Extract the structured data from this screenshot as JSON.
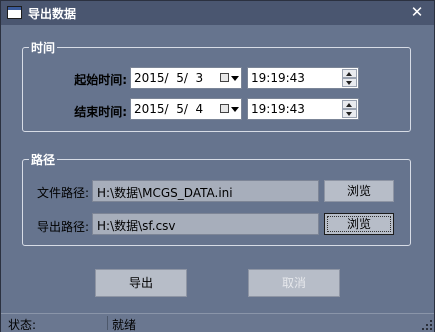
{
  "window": {
    "title": "导出数据",
    "close_glyph": "✕"
  },
  "time_group": {
    "title": "时间",
    "start_label": "起始时间:",
    "start_date": "2015/  5/  3",
    "start_time": "19:19:43",
    "end_label": "结束时间:",
    "end_date": "2015/  5/  4",
    "end_time": "19:19:43"
  },
  "path_group": {
    "title": "路径",
    "file_label": "文件路径:",
    "file_path": "H:\\数据\\MCGS_DATA.ini",
    "file_browse": "浏览",
    "export_label": "导出路径:",
    "export_path": "H:\\数据\\sf.csv",
    "export_browse": "浏览"
  },
  "actions": {
    "export": "导出",
    "cancel": "取消"
  },
  "statusbar": {
    "label": "状态:",
    "value": "就绪"
  }
}
